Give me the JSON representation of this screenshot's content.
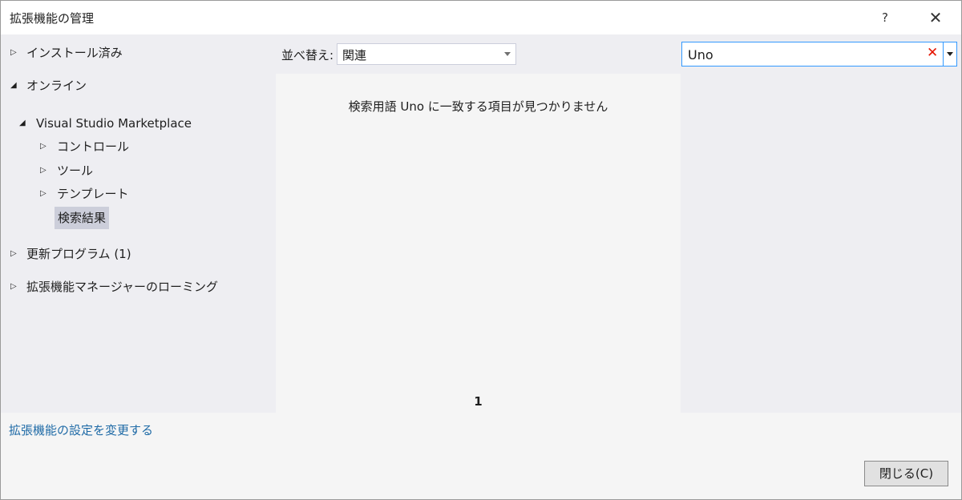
{
  "window": {
    "title": "拡張機能の管理",
    "help": "?",
    "close": "✕"
  },
  "tree": {
    "installed": "インストール済み",
    "online": "オンライン",
    "marketplace": "Visual Studio Marketplace",
    "controls": "コントロール",
    "tools": "ツール",
    "templates": "テンプレート",
    "search_results": "検索結果",
    "updates": "更新プログラム (1)",
    "roaming": "拡張機能マネージャーのローミング"
  },
  "sort": {
    "label": "並べ替え:",
    "value": "関連"
  },
  "list": {
    "no_results": "検索用語 Uno に一致する項目が見つかりません",
    "page": "1"
  },
  "search": {
    "value": "Uno",
    "clear": "✕"
  },
  "footer": {
    "settings_link": "拡張機能の設定を変更する",
    "close_button": "閉じる(C)"
  }
}
